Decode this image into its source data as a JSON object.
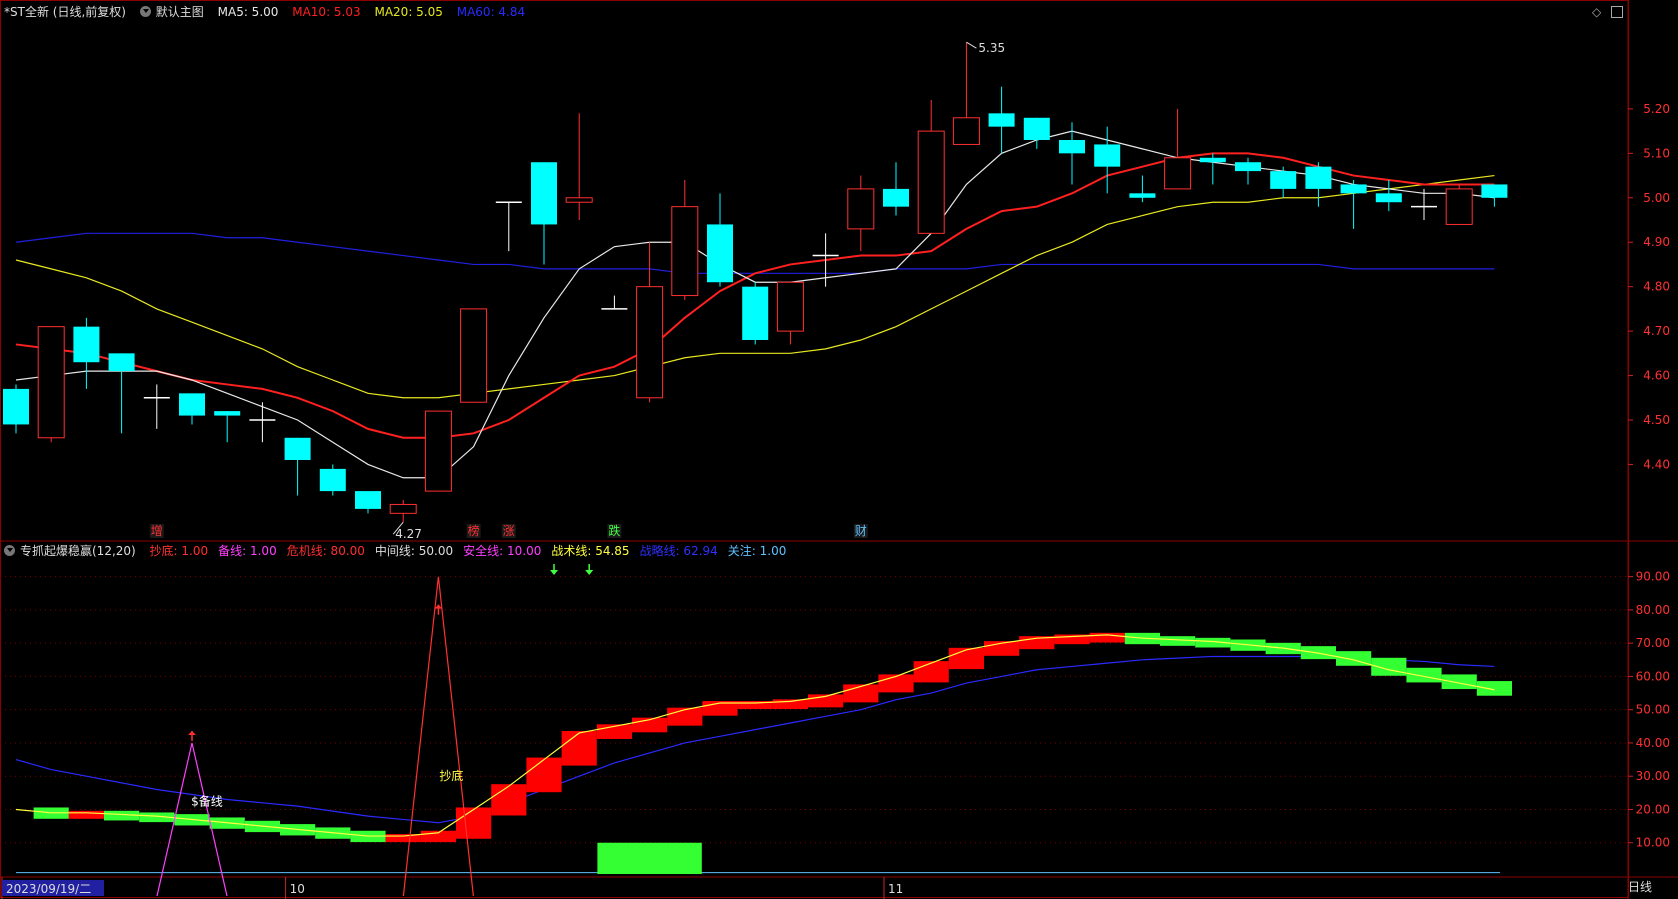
{
  "main_header": {
    "title": "*ST全新 (日线,前复权)",
    "main_chart_btn": "默认主图",
    "ma5": "MA5: 5.00",
    "ma10": "MA10: 5.03",
    "ma20": "MA20: 5.05",
    "ma60": "MA60: 4.84"
  },
  "ind_header": {
    "name": "专抓起爆稳赢(12,20)",
    "items": [
      {
        "text": "抄底: 1.00",
        "color": "#ff3030"
      },
      {
        "text": "备线: 1.00",
        "color": "#ff40ff"
      },
      {
        "text": "危机线: 80.00",
        "color": "#ff3030"
      },
      {
        "text": "中间线: 50.00",
        "color": "#dddddd"
      },
      {
        "text": "安全线: 10.00",
        "color": "#ff40ff"
      },
      {
        "text": "战术线: 54.85",
        "color": "#ffff40"
      },
      {
        "text": "战略线: 62.94",
        "color": "#3030ff"
      },
      {
        "text": "关注: 1.00",
        "color": "#60c0ff"
      }
    ]
  },
  "colors": {
    "up": "#ff3030",
    "down": "#00ffff",
    "ma5": "#e8e8e8",
    "ma10": "#ff2020",
    "ma20": "#e8e820",
    "ma60": "#2020e0",
    "grid": "#8b0000"
  },
  "chart_data": {
    "type": "candlestick",
    "y_ticks": [
      "5.20",
      "5.10",
      "5.00",
      "4.90",
      "4.80",
      "4.70",
      "4.60",
      "4.50",
      "4.40"
    ],
    "ylim": [
      4.23,
      5.4
    ],
    "max_label": "5.35",
    "min_label": "4.27",
    "candles": [
      {
        "o": 4.57,
        "c": 4.49,
        "h": 4.58,
        "l": 4.47
      },
      {
        "o": 4.46,
        "c": 4.71,
        "h": 4.71,
        "l": 4.45
      },
      {
        "o": 4.71,
        "c": 4.63,
        "h": 4.73,
        "l": 4.57
      },
      {
        "o": 4.65,
        "c": 4.61,
        "h": 4.65,
        "l": 4.47
      },
      {
        "o": 4.55,
        "c": 4.55,
        "h": 4.58,
        "l": 4.48
      },
      {
        "o": 4.56,
        "c": 4.51,
        "h": 4.56,
        "l": 4.49
      },
      {
        "o": 4.52,
        "c": 4.51,
        "h": 4.52,
        "l": 4.45
      },
      {
        "o": 4.5,
        "c": 4.5,
        "h": 4.54,
        "l": 4.45
      },
      {
        "o": 4.46,
        "c": 4.41,
        "h": 4.46,
        "l": 4.33
      },
      {
        "o": 4.39,
        "c": 4.34,
        "h": 4.4,
        "l": 4.33
      },
      {
        "o": 4.34,
        "c": 4.3,
        "h": 4.34,
        "l": 4.29
      },
      {
        "o": 4.29,
        "c": 4.31,
        "h": 4.32,
        "l": 4.27
      },
      {
        "o": 4.34,
        "c": 4.52,
        "h": 4.52,
        "l": 4.34
      },
      {
        "o": 4.54,
        "c": 4.75,
        "h": 4.75,
        "l": 4.54
      },
      {
        "o": 4.99,
        "c": 4.99,
        "h": 4.99,
        "l": 4.88
      },
      {
        "o": 5.08,
        "c": 4.94,
        "h": 5.08,
        "l": 4.85
      },
      {
        "o": 4.99,
        "c": 5.0,
        "h": 5.19,
        "l": 4.95
      },
      {
        "o": 4.75,
        "c": 4.75,
        "h": 4.78,
        "l": 4.75
      },
      {
        "o": 4.55,
        "c": 4.8,
        "h": 4.9,
        "l": 4.54
      },
      {
        "o": 4.78,
        "c": 4.98,
        "h": 5.04,
        "l": 4.77
      },
      {
        "o": 4.94,
        "c": 4.81,
        "h": 5.01,
        "l": 4.8
      },
      {
        "o": 4.8,
        "c": 4.68,
        "h": 4.81,
        "l": 4.67
      },
      {
        "o": 4.7,
        "c": 4.81,
        "h": 4.81,
        "l": 4.67
      },
      {
        "o": 4.87,
        "c": 4.87,
        "h": 4.92,
        "l": 4.8
      },
      {
        "o": 4.93,
        "c": 5.02,
        "h": 5.05,
        "l": 4.88
      },
      {
        "o": 5.02,
        "c": 4.98,
        "h": 5.08,
        "l": 4.96
      },
      {
        "o": 4.92,
        "c": 5.15,
        "h": 5.22,
        "l": 4.92
      },
      {
        "o": 5.12,
        "c": 5.18,
        "h": 5.35,
        "l": 5.12
      },
      {
        "o": 5.19,
        "c": 5.16,
        "h": 5.25,
        "l": 5.1
      },
      {
        "o": 5.18,
        "c": 5.13,
        "h": 5.18,
        "l": 5.11
      },
      {
        "o": 5.13,
        "c": 5.1,
        "h": 5.17,
        "l": 5.03
      },
      {
        "o": 5.12,
        "c": 5.07,
        "h": 5.16,
        "l": 5.01
      },
      {
        "o": 5.01,
        "c": 5.0,
        "h": 5.05,
        "l": 4.99
      },
      {
        "o": 5.02,
        "c": 5.09,
        "h": 5.2,
        "l": 5.02
      },
      {
        "o": 5.09,
        "c": 5.08,
        "h": 5.1,
        "l": 5.03
      },
      {
        "o": 5.08,
        "c": 5.06,
        "h": 5.09,
        "l": 5.03
      },
      {
        "o": 5.06,
        "c": 5.02,
        "h": 5.07,
        "l": 5.0
      },
      {
        "o": 5.07,
        "c": 5.02,
        "h": 5.08,
        "l": 4.98
      },
      {
        "o": 5.03,
        "c": 5.01,
        "h": 5.04,
        "l": 4.93
      },
      {
        "o": 5.01,
        "c": 4.99,
        "h": 5.04,
        "l": 4.97
      },
      {
        "o": 4.98,
        "c": 4.98,
        "h": 5.02,
        "l": 4.95
      },
      {
        "o": 4.94,
        "c": 5.02,
        "h": 5.03,
        "l": 4.94
      },
      {
        "o": 5.03,
        "c": 5.0,
        "h": 5.03,
        "l": 4.98
      }
    ],
    "ma5": [
      4.59,
      4.6,
      4.61,
      4.61,
      4.61,
      4.59,
      4.56,
      4.53,
      4.5,
      4.45,
      4.4,
      4.37,
      4.37,
      4.44,
      4.6,
      4.73,
      4.84,
      4.89,
      4.9,
      4.9,
      4.85,
      4.81,
      4.81,
      4.82,
      4.83,
      4.84,
      4.92,
      5.03,
      5.1,
      5.13,
      5.15,
      5.13,
      5.11,
      5.09,
      5.08,
      5.07,
      5.06,
      5.05,
      5.03,
      5.02,
      5.01,
      5.01,
      5.0
    ],
    "ma10": [
      4.67,
      4.66,
      4.65,
      4.63,
      4.61,
      4.59,
      4.58,
      4.57,
      4.55,
      4.52,
      4.48,
      4.46,
      4.46,
      4.47,
      4.5,
      4.55,
      4.6,
      4.62,
      4.66,
      4.73,
      4.79,
      4.83,
      4.85,
      4.86,
      4.87,
      4.87,
      4.88,
      4.93,
      4.97,
      4.98,
      5.01,
      5.05,
      5.07,
      5.09,
      5.1,
      5.1,
      5.09,
      5.07,
      5.05,
      5.04,
      5.03,
      5.03,
      5.03
    ],
    "ma20": [
      4.86,
      4.84,
      4.82,
      4.79,
      4.75,
      4.72,
      4.69,
      4.66,
      4.62,
      4.59,
      4.56,
      4.55,
      4.55,
      4.56,
      4.57,
      4.58,
      4.59,
      4.6,
      4.62,
      4.64,
      4.65,
      4.65,
      4.65,
      4.66,
      4.68,
      4.71,
      4.75,
      4.79,
      4.83,
      4.87,
      4.9,
      4.94,
      4.96,
      4.98,
      4.99,
      4.99,
      5.0,
      5.0,
      5.01,
      5.02,
      5.03,
      5.04,
      5.05
    ],
    "ma60": [
      4.9,
      4.91,
      4.92,
      4.92,
      4.92,
      4.92,
      4.91,
      4.91,
      4.9,
      4.89,
      4.88,
      4.87,
      4.86,
      4.85,
      4.85,
      4.84,
      4.84,
      4.84,
      4.84,
      4.83,
      4.83,
      4.83,
      4.83,
      4.83,
      4.83,
      4.84,
      4.84,
      4.84,
      4.85,
      4.85,
      4.85,
      4.85,
      4.85,
      4.85,
      4.85,
      4.85,
      4.85,
      4.85,
      4.84,
      4.84,
      4.84,
      4.84,
      4.84
    ],
    "events": [
      {
        "index": 4,
        "text": "增",
        "color": "#ff3030"
      },
      {
        "index": 13,
        "text": "榜",
        "color": "#ff3030"
      },
      {
        "index": 14,
        "text": "涨",
        "color": "#ff3030"
      },
      {
        "index": 17,
        "text": "跌",
        "color": "#40ff40"
      },
      {
        "index": 24,
        "text": "财",
        "color": "#60c0ff"
      }
    ],
    "indicator": {
      "y_ticks": [
        "90.00",
        "80.00",
        "70.00",
        "60.00",
        "50.00",
        "40.00",
        "30.00",
        "20.00",
        "10.00"
      ],
      "ylim": [
        0,
        95
      ],
      "tactic": [
        20,
        19,
        19,
        18.5,
        18,
        17,
        16,
        15,
        14,
        13,
        12,
        12,
        13,
        20,
        27,
        35,
        43,
        45,
        47,
        50,
        52,
        52,
        52.5,
        54,
        57,
        60,
        64,
        68,
        70,
        71.5,
        72,
        72.5,
        71.5,
        71,
        70.5,
        69.5,
        68.5,
        67,
        65,
        62,
        60,
        58,
        56
      ],
      "strategy": [
        35,
        32,
        30,
        28,
        26,
        24.5,
        23,
        22,
        21,
        19.5,
        18,
        17,
        16,
        18,
        22,
        26,
        30,
        34,
        37,
        40,
        42,
        44,
        46,
        48,
        50,
        53,
        55,
        58,
        60,
        62,
        63,
        64,
        65,
        65.5,
        66,
        66,
        66,
        66,
        65.5,
        65,
        64.5,
        63.5,
        63
      ],
      "spikes": [
        {
          "index": 5,
          "value": 40,
          "color": "#ff40ff",
          "label": "$备线",
          "arrow": "#ff3030"
        },
        {
          "index": 12,
          "value": 90,
          "color": "#ff3030",
          "label": "抄底",
          "arrow": "#ff3030"
        }
      ],
      "down_arrows": [
        15,
        16
      ],
      "green_block": [
        17,
        19
      ],
      "green_block_value": 10
    },
    "date_labels": [
      {
        "index": 0,
        "text": "2023/09/19/二",
        "highlight": true
      },
      {
        "index": 8,
        "text": "10",
        "highlight": false
      },
      {
        "index": 25,
        "text": "11",
        "highlight": false
      }
    ],
    "period_label": "日线"
  }
}
